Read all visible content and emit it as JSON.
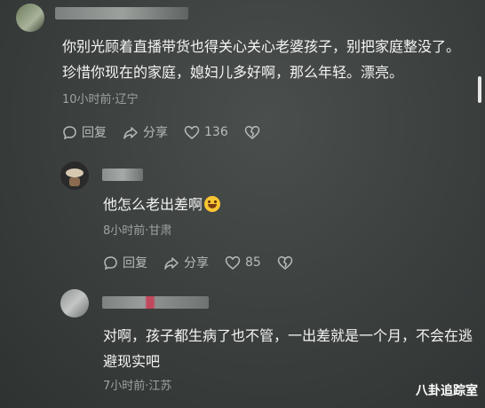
{
  "comments": [
    {
      "text": "你别光顾着直播带货也得关心关心老婆孩子，别把家庭整没了。珍惜你现在的家庭，媳妇儿多好啊，那么年轻。漂亮。",
      "meta": "10小时前·辽宁",
      "reply_label": "回复",
      "share_label": "分享",
      "like_count": "136"
    },
    {
      "text": "他怎么老出差啊",
      "meta": "8小时前·甘肃",
      "reply_label": "回复",
      "share_label": "分享",
      "like_count": "85"
    },
    {
      "text": "对啊，孩子都生病了也不管，一出差就是一个月，不会在逃避现实吧",
      "meta": "7小时前·江苏"
    }
  ],
  "watermark": "八卦追踪室",
  "colors": {
    "background": "#3a3e3d",
    "text": "#f4f4f4",
    "meta": "#9ea3a1",
    "accent_emoji": "#f6c632"
  },
  "icons": [
    "comment-icon",
    "share-icon",
    "heart-icon",
    "broken-heart-icon",
    "laugh-emoji-icon"
  ]
}
